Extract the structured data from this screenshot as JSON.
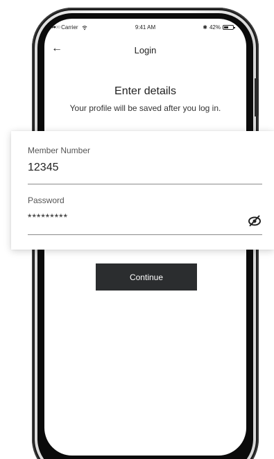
{
  "status_bar": {
    "carrier": "Carrier",
    "time": "9:41 AM",
    "bluetooth": "✱",
    "battery": "42%"
  },
  "header": {
    "back_icon": "←",
    "title": "Login"
  },
  "main": {
    "heading": "Enter details",
    "subheading": "Your profile will be saved after you log in.",
    "continue_label": "Continue"
  },
  "form": {
    "member_number": {
      "label": "Member Number",
      "value": "12345"
    },
    "password": {
      "label": "Password",
      "value": "*********",
      "toggle_icon": "eye-slash-icon"
    }
  },
  "colors": {
    "button_bg": "#2b2d2f",
    "text": "#222222",
    "underline": "#8a8a8a"
  }
}
